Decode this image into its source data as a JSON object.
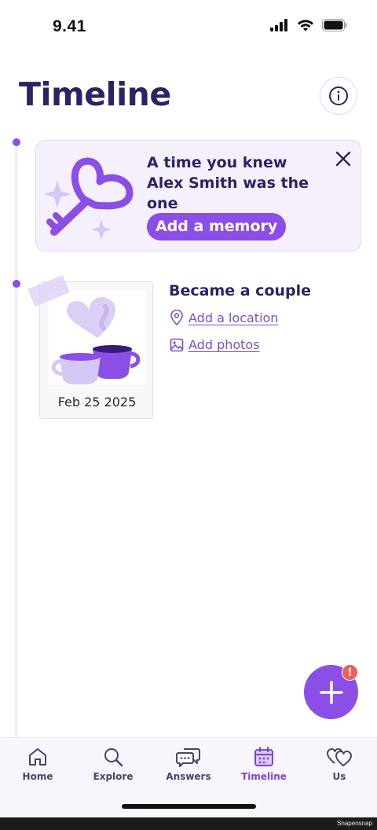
{
  "status_bar": {
    "time": "9.41"
  },
  "page": {
    "title": "Timeline"
  },
  "memory_prompt": {
    "text": "A time you knew Alex Smith was the one",
    "button_label": "Add a memory"
  },
  "event": {
    "title": "Became a couple",
    "date": "Feb 25 2025",
    "add_location_label": "Add a location",
    "add_photos_label": "Add photos"
  },
  "fab": {
    "badge": "!"
  },
  "tabs": [
    {
      "label": "Home",
      "icon": "home-icon",
      "active": false
    },
    {
      "label": "Explore",
      "icon": "search-icon",
      "active": false
    },
    {
      "label": "Answers",
      "icon": "chat-bubbles-icon",
      "active": false
    },
    {
      "label": "Timeline",
      "icon": "calendar-icon",
      "active": true
    },
    {
      "label": "Us",
      "icon": "hearts-icon",
      "active": false
    }
  ],
  "watermark": "Snapensnap",
  "colors": {
    "accent": "#8b4ee6",
    "title": "#2d2266",
    "badge": "#e8615a",
    "card_bg": "#f5f0fc"
  }
}
